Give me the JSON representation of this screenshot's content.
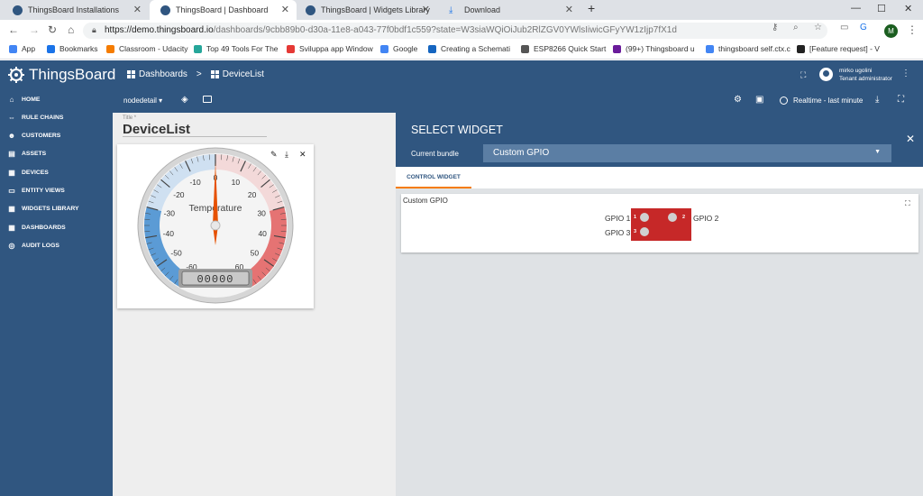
{
  "browser": {
    "tabs": [
      {
        "title": "ThingsBoard Installations"
      },
      {
        "title": "ThingsBoard | Dashboard"
      },
      {
        "title": "ThingsBoard | Widgets Library"
      },
      {
        "title": "Download"
      }
    ],
    "url_host": "https://demo.thingsboard.io",
    "url_path": "/dashboards/9cbb89b0-d30a-11e8-a043-77f0bdf1c559?state=W3siaWQiOiJub2RlZGV0YWlsIiwicGFyYW1zIjp7fX1d",
    "profile_initial": "M",
    "bookmarks": [
      {
        "label": "App",
        "color": "#4285f4"
      },
      {
        "label": "Bookmarks",
        "color": "#1a73e8"
      },
      {
        "label": "Classroom - Udacity",
        "color": "#f57c00"
      },
      {
        "label": "Top 49 Tools For The",
        "color": "#26a69a"
      },
      {
        "label": "Sviluppa app Window",
        "color": "#e53935"
      },
      {
        "label": "Google",
        "color": "#4285f4"
      },
      {
        "label": "Creating a Schemati",
        "color": "#1565c0"
      },
      {
        "label": "ESP8266 Quick Start",
        "color": "#555555"
      },
      {
        "label": "(99+) Thingsboard u",
        "color": "#6a1b9a"
      },
      {
        "label": "thingsboard self.ctx.c",
        "color": "#4285f4"
      },
      {
        "label": "[Feature request] - V",
        "color": "#222222"
      }
    ]
  },
  "app": {
    "logo_text": "ThingsBoard",
    "breadcrumb": {
      "root": "Dashboards",
      "separator": ">",
      "current": "DeviceList"
    },
    "user": {
      "name": "mirko ugolini",
      "role": "Tenant administrator"
    }
  },
  "sidebar": {
    "items": [
      {
        "label": "HOME",
        "icon": "home-icon"
      },
      {
        "label": "RULE CHAINS",
        "icon": "rule-chains-icon"
      },
      {
        "label": "CUSTOMERS",
        "icon": "customers-icon"
      },
      {
        "label": "ASSETS",
        "icon": "assets-icon"
      },
      {
        "label": "DEVICES",
        "icon": "devices-icon"
      },
      {
        "label": "ENTITY VIEWS",
        "icon": "entity-views-icon"
      },
      {
        "label": "WIDGETS LIBRARY",
        "icon": "widgets-library-icon"
      },
      {
        "label": "DASHBOARDS",
        "icon": "dashboards-icon"
      },
      {
        "label": "AUDIT LOGS",
        "icon": "audit-logs-icon"
      }
    ]
  },
  "toolbar": {
    "state": "nodedetail",
    "timewindow": "Realtime - last minute"
  },
  "dashboard": {
    "title_label": "Title *",
    "title": "DeviceList"
  },
  "gauge": {
    "label": "Temperature",
    "value": 0,
    "min": -60,
    "max": 60,
    "ticks": [
      "-60",
      "-50",
      "-40",
      "-30",
      "-20",
      "-10",
      "0",
      "10",
      "20",
      "30",
      "40",
      "50",
      "60"
    ],
    "lcd_display": "00000",
    "colors": {
      "cold": "#5b9bd5",
      "hot": "#e57373",
      "needle": "#e65100"
    }
  },
  "select_widget": {
    "title": "SELECT WIDGET",
    "bundle_label": "Current bundle",
    "bundle_value": "Custom GPIO",
    "tab": "CONTROL WIDGET",
    "widget_title": "Custom GPIO",
    "gpio": {
      "labels": [
        "GPIO 1",
        "GPIO 2",
        "GPIO 3"
      ],
      "pins": [
        "1",
        "2",
        "3"
      ],
      "board_color": "#c62828"
    }
  }
}
